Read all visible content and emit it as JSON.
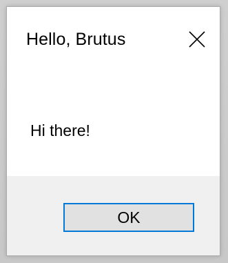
{
  "dialog": {
    "title": "Hello, Brutus",
    "message": "Hi there!",
    "ok_label": "OK",
    "close_icon": "close-icon"
  },
  "colors": {
    "button_border": "#0078d7",
    "button_fill": "#e1e1e1",
    "footer_bg": "#f0f0f0",
    "dialog_bg": "#ffffff"
  }
}
